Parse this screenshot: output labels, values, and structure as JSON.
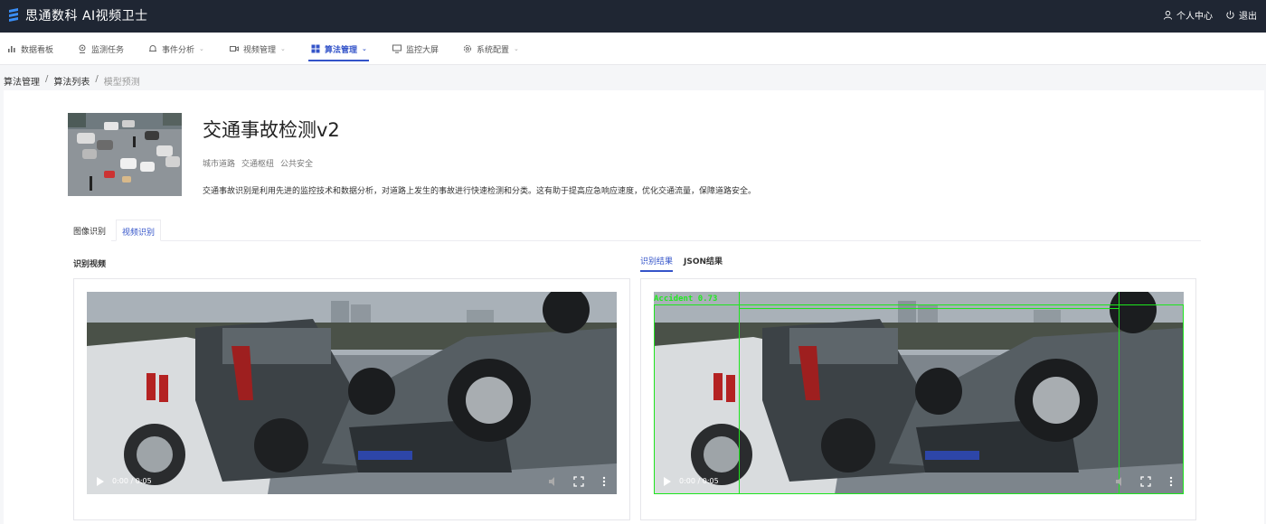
{
  "app": {
    "title": "思通数科 AI视频卫士"
  },
  "header": {
    "actions": [
      {
        "label": "个人中心",
        "icon": "user-icon"
      },
      {
        "label": "退出",
        "icon": "power-icon"
      }
    ]
  },
  "nav": {
    "items": [
      {
        "label": "数据看板",
        "icon": "bar-chart-icon",
        "has_dropdown": false,
        "active": false
      },
      {
        "label": "监测任务",
        "icon": "camera-icon",
        "has_dropdown": false,
        "active": false
      },
      {
        "label": "事件分析",
        "icon": "bell-icon",
        "has_dropdown": true,
        "active": false
      },
      {
        "label": "视频管理",
        "icon": "video-icon",
        "has_dropdown": true,
        "active": false
      },
      {
        "label": "算法管理",
        "icon": "grid-icon",
        "has_dropdown": true,
        "active": true
      },
      {
        "label": "监控大屏",
        "icon": "monitor-icon",
        "has_dropdown": false,
        "active": false
      },
      {
        "label": "系统配置",
        "icon": "settings-icon",
        "has_dropdown": true,
        "active": false
      }
    ]
  },
  "breadcrumb": [
    "算法管理",
    "算法列表",
    "模型预测"
  ],
  "breadcrumb_sep": "/",
  "algorithm": {
    "title": "交通事故检测v2",
    "tags": [
      "城市道路",
      "交通枢纽",
      "公共安全"
    ],
    "description": "交通事故识别是利用先进的监控技术和数据分析，对道路上发生的事故进行快速检测和分类。这有助于提高应急响应速度，优化交通流量，保障道路安全。"
  },
  "tabs": {
    "image": "图像识别",
    "video": "视频识别",
    "active": "视频识别"
  },
  "left_panel": {
    "label": "识别视频",
    "time": "0:00 / 0:05",
    "progress": 0
  },
  "right_panel": {
    "tabs": [
      "识别结果",
      "JSON结果"
    ],
    "active_tab": "识别结果",
    "time": "0:00 / 0:05",
    "progress": 0,
    "detection_label": "Accident  0.73",
    "detection_color": "#22e822"
  },
  "colors": {
    "primary": "#3454c9",
    "header_bg": "#1f2633"
  }
}
